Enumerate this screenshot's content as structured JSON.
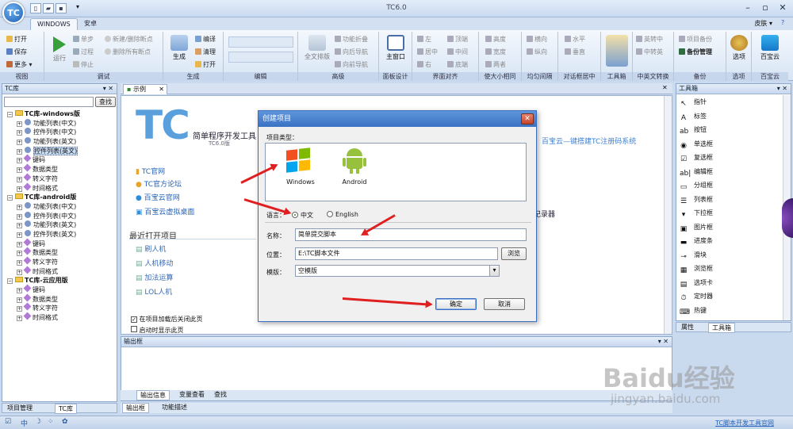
{
  "window": {
    "title": "TC6.0",
    "logo": "TC"
  },
  "quick_access": [
    "new-icon",
    "open-icon",
    "save-icon"
  ],
  "tabs": [
    {
      "label": "WINDOWS"
    },
    {
      "label": "安卓"
    }
  ],
  "skin_label": "皮肤 ▾",
  "ribbon": {
    "groups": {
      "view": {
        "label": "视图",
        "items": [
          "打开",
          "保存",
          "更多 ▾"
        ]
      },
      "debug": {
        "label": "调试",
        "run": "运行",
        "items": [
          "单步",
          "过程",
          "停止",
          "新建/删除断点",
          "删除所有断点"
        ]
      },
      "build": {
        "label": "生成",
        "big": "生成",
        "items": [
          "编译",
          "清理",
          "打开"
        ]
      },
      "edit": {
        "label": "编辑"
      },
      "advanced": {
        "label": "高级",
        "big": "全文排版",
        "items": [
          "功能折叠",
          "向后导航",
          "向前导航"
        ]
      },
      "panel": {
        "label": "面板设计",
        "big": "主窗口"
      },
      "align": {
        "label": "界面对齐",
        "items": [
          "左",
          "居中",
          "右",
          "顶端",
          "中间",
          "底端"
        ]
      },
      "size": {
        "label": "使大小相同",
        "items": [
          "高度",
          "宽度",
          "两者"
        ]
      },
      "even": {
        "label": "均匀间隔",
        "items": [
          "横向",
          "纵向"
        ]
      },
      "center": {
        "label": "对话框居中",
        "items": [
          "水平",
          "垂直"
        ]
      },
      "tools": {
        "label": "工具箱"
      },
      "cnen": {
        "label": "中英文转换",
        "items": [
          "英转中",
          "中转英"
        ]
      },
      "backup": {
        "label": "备份",
        "items": [
          "项目备份",
          "备份管理"
        ]
      },
      "options": {
        "label": "选项",
        "big": "选项"
      },
      "cloud": {
        "label": "百宝云",
        "big": "百宝云"
      }
    }
  },
  "left_panel": {
    "title": "TC库",
    "find_button": "查找",
    "tree": [
      {
        "label": "TC库-windows版",
        "type": "folder",
        "level": 0
      },
      {
        "label": "功能列表(中文)",
        "type": "gear",
        "level": 1
      },
      {
        "label": "控件列表(中文)",
        "type": "gear",
        "level": 1
      },
      {
        "label": "功能列表(英文)",
        "type": "gear",
        "level": 1
      },
      {
        "label": "控件列表(英文)",
        "type": "gear",
        "level": 1,
        "selected": true
      },
      {
        "label": "键码",
        "type": "leaf",
        "level": 1
      },
      {
        "label": "数据类型",
        "type": "leaf",
        "level": 1
      },
      {
        "label": "转义字符",
        "type": "leaf",
        "level": 1
      },
      {
        "label": "时间格式",
        "type": "leaf",
        "level": 1
      },
      {
        "label": "TC库-android版",
        "type": "folder",
        "level": 0
      },
      {
        "label": "功能列表(中文)",
        "type": "gear",
        "level": 1
      },
      {
        "label": "控件列表(中文)",
        "type": "gear",
        "level": 1
      },
      {
        "label": "功能列表(英文)",
        "type": "gear",
        "level": 1
      },
      {
        "label": "控件列表(英文)",
        "type": "gear",
        "level": 1
      },
      {
        "label": "键码",
        "type": "leaf",
        "level": 1
      },
      {
        "label": "数据类型",
        "type": "leaf",
        "level": 1
      },
      {
        "label": "转义字符",
        "type": "leaf",
        "level": 1
      },
      {
        "label": "时间格式",
        "type": "leaf",
        "level": 1
      },
      {
        "label": "TC库-云应用版",
        "type": "folder",
        "level": 0
      },
      {
        "label": "键码",
        "type": "leaf",
        "level": 1
      },
      {
        "label": "数据类型",
        "type": "leaf",
        "level": 1
      },
      {
        "label": "转义字符",
        "type": "leaf",
        "level": 1
      },
      {
        "label": "时间格式",
        "type": "leaf",
        "level": 1
      }
    ],
    "bottom_tabs": [
      "项目管理",
      "TC库"
    ]
  },
  "doc_tab": "示例",
  "start_page": {
    "logo": "TC",
    "subtitle": "简单程序开发工具",
    "version": "TC6.0版",
    "banner": "百宝云—键搭建TC注册码系统",
    "links": [
      "TC官网",
      "TC官方论坛",
      "百宝云官网",
      "百宝云虚拟桌面"
    ],
    "recorder_fragment": "记录器",
    "recent_title": "最近打开项目",
    "recent": [
      "刷人机",
      "人机移动",
      "加法运算",
      "LOL人机"
    ],
    "check1": "在项目加载后关闭此页",
    "check2": "启动时显示此页"
  },
  "dialog": {
    "title": "创建项目",
    "close": "✕",
    "type_label": "项目类型：",
    "types": [
      {
        "label": "Windows"
      },
      {
        "label": "Android"
      }
    ],
    "lang_label": "语言：",
    "lang_options": [
      "中文",
      "English"
    ],
    "lang_selected": "中文",
    "name_label": "名称：",
    "name_value": "简单提交脚本",
    "location_label": "位置：",
    "location_value": "E:\\TC脚本文件",
    "browse": "浏览",
    "template_label": "模版：",
    "template_value": "空模版",
    "ok": "确定",
    "cancel": "取消"
  },
  "toolbox": {
    "title": "工具箱",
    "items": [
      "指针",
      "标签",
      "按钮",
      "单选框",
      "复选框",
      "编辑框",
      "分组框",
      "列表框",
      "下拉框",
      "图片框",
      "进度条",
      "滑块",
      "浏览框",
      "选项卡",
      "定时器",
      "热键"
    ],
    "icons": [
      "↖",
      "A",
      "ab",
      "◉",
      "☑",
      "ab|",
      "▭",
      "☰",
      "▾",
      "▣",
      "▬",
      "⊸",
      "▦",
      "▤",
      "⏱",
      "⌨"
    ],
    "bottom_tabs": [
      "属性",
      "工具箱"
    ]
  },
  "output": {
    "title": "输出框",
    "tabs": [
      "输出信息",
      "变量查看",
      "查找"
    ],
    "bottom_tabs": [
      "输出框",
      "功能描述"
    ]
  },
  "status": {
    "right_link": "TC脚本开发工具官网",
    "icons": [
      "check-icon",
      "cn-icon",
      "moon-icon",
      "dots-icon",
      "gear-icon"
    ]
  },
  "watermark": {
    "brand": "Baidu经验",
    "url": "jingyan.baidu.com"
  }
}
